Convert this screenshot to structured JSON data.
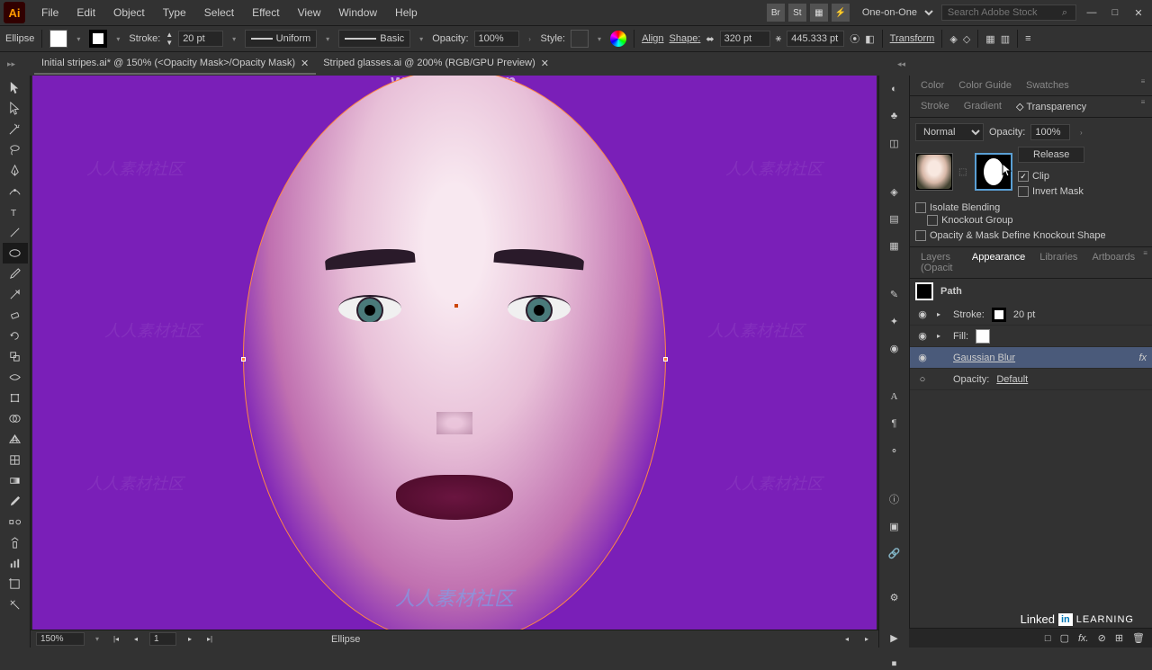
{
  "menu": [
    "File",
    "Edit",
    "Object",
    "Type",
    "Select",
    "Effect",
    "View",
    "Window",
    "Help"
  ],
  "workspace": "One-on-One",
  "search_placeholder": "Search Adobe Stock",
  "control": {
    "tool": "Ellipse",
    "fill_label": "Fill:",
    "stroke_label": "Stroke:",
    "stroke_weight": "20 pt",
    "stroke_profile": "Uniform",
    "brush_def": "Basic",
    "opacity_label": "Opacity:",
    "opacity": "100%",
    "style_label": "Style:",
    "align_label": "Align",
    "shape_label": "Shape:",
    "width": "320 pt",
    "height": "445.333 pt",
    "transform_label": "Transform"
  },
  "tabs": [
    {
      "title": "Initial stripes.ai* @ 150% (<Opacity Mask>/Opacity Mask)",
      "active": true
    },
    {
      "title": "Striped glasses.ai @ 200% (RGB/GPU Preview)",
      "active": false
    }
  ],
  "status": {
    "zoom": "150%",
    "artboard": "1",
    "tool": "Ellipse"
  },
  "watermark_top": "www.rrcg.cn",
  "watermark_body": "人人素材社区",
  "panel_group1": [
    "Color",
    "Color Guide",
    "Swatches"
  ],
  "panel_group2": [
    "Stroke",
    "Gradient",
    "Transparency"
  ],
  "transparency": {
    "blend": "Normal",
    "opacity_label": "Opacity:",
    "opacity": "100%",
    "release": "Release",
    "clip": "Clip",
    "invert": "Invert Mask",
    "isolate": "Isolate Blending",
    "knockout": "Knockout Group",
    "define": "Opacity & Mask Define Knockout Shape"
  },
  "panel_group3": [
    "Layers (Opacit",
    "Appearance",
    "Libraries",
    "Artboards"
  ],
  "appearance": {
    "path": "Path",
    "stroke": "Stroke:",
    "stroke_val": "20 pt",
    "fill": "Fill:",
    "gaussian": "Gaussian Blur",
    "opacity": "Opacity:",
    "opacity_val": "Default",
    "fx": "fx"
  },
  "branding": {
    "linked": "Linked",
    "in": "in",
    "learning": "LEARNING"
  }
}
